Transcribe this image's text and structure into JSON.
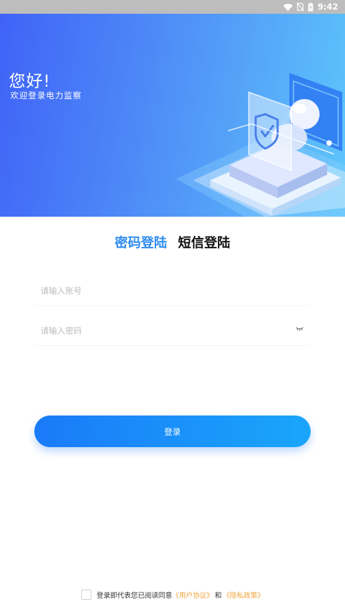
{
  "status_bar": {
    "time": "9:42",
    "icons": [
      "wifi-icon",
      "no-sim-icon",
      "battery-icon"
    ]
  },
  "hero": {
    "greeting": "您好!",
    "welcome": "欢迎登录电力监察",
    "illustration": "security-shield-illustration"
  },
  "tabs": [
    {
      "label": "密码登陆",
      "active": true
    },
    {
      "label": "短信登陆",
      "active": false
    }
  ],
  "form": {
    "account_placeholder": "请输入账号",
    "account_value": "",
    "password_placeholder": "请输入密码",
    "password_value": "",
    "password_visibility_icon": "eye-closed-icon"
  },
  "login_button": "登录",
  "agreement": {
    "checked": false,
    "prefix": "登录即代表您已阅读同意",
    "user_agreement": "《用户协议》",
    "conjunction": "和",
    "privacy_policy": "《隐私政策》"
  },
  "colors": {
    "accent": "#2e8cf0",
    "link": "#f0a640",
    "hero_gradient_start": "#3f63f7",
    "hero_gradient_end": "#5ec6fb"
  }
}
